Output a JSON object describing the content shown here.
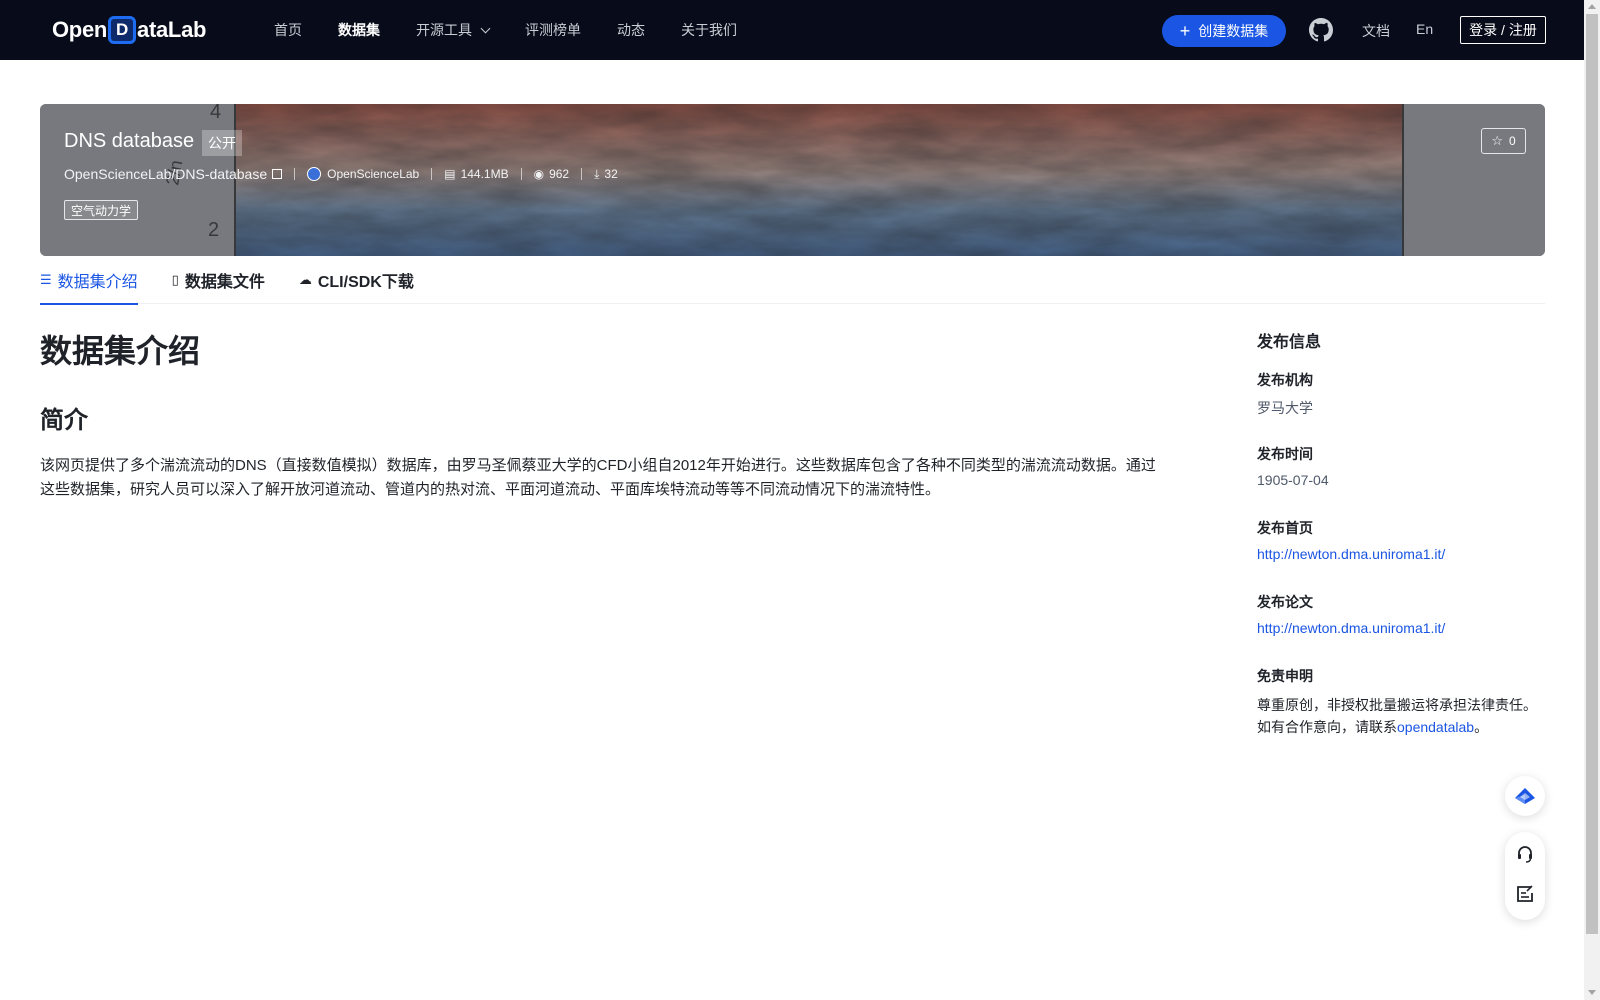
{
  "header": {
    "logo_text_left": "Open",
    "logo_mark": "D",
    "logo_text_right": "ataLab",
    "nav": [
      {
        "label": "首页"
      },
      {
        "label": "数据集"
      },
      {
        "label": "开源工具"
      },
      {
        "label": "评测榜单"
      },
      {
        "label": "动态"
      },
      {
        "label": "关于我们"
      }
    ],
    "create_label": "创建数据集",
    "docs_label": "文档",
    "lang_label": "En",
    "login_label": "登录 / 注册",
    "colors": {
      "bg": "#070b1a",
      "accent": "#1a55e3"
    }
  },
  "dataset": {
    "title": "DNS database",
    "visibility": "公开",
    "path": "OpenScienceLab/DNS-database",
    "org": "OpenScienceLab",
    "size": "144.1MB",
    "views": "962",
    "downloads": "32",
    "tag": "空气动力学",
    "stars": "0",
    "banner_labels": {
      "a": "4",
      "b": "2",
      "c": "2/n"
    }
  },
  "tabs": [
    {
      "label": "数据集介绍",
      "icon": "database-icon"
    },
    {
      "label": "数据集文件",
      "icon": "file-icon"
    },
    {
      "label": "CLI/SDK下载",
      "icon": "cloud-download-icon"
    }
  ],
  "content": {
    "heading": "数据集介绍",
    "subheading": "简介",
    "description": "该网页提供了多个湍流流动的DNS（直接数值模拟）数据库，由罗马圣佩蔡亚大学的CFD小组自2012年开始进行。这些数据库包含了各种不同类型的湍流流动数据。通过这些数据集，研究人员可以深入了解开放河道流动、管道内的热对流、平面河道流动、平面库埃特流动等等不同流动情况下的湍流特性。"
  },
  "sidebar": {
    "title": "发布信息",
    "org_label": "发布机构",
    "org_value": "罗马大学",
    "time_label": "发布时间",
    "time_value": "1905-07-04",
    "home_label": "发布首页",
    "home_value": "http://newton.dma.uniroma1.it/",
    "paper_label": "发布论文",
    "paper_value": "http://newton.dma.uniroma1.it/",
    "disclaimer_label": "免责申明",
    "disclaimer_line1": "尊重原创，非授权批量搬运将承担法律责任。",
    "disclaimer_line2_prefix": "如有合作意向，请联系",
    "disclaimer_link": "opendatalab",
    "disclaimer_line2_suffix": "。"
  }
}
